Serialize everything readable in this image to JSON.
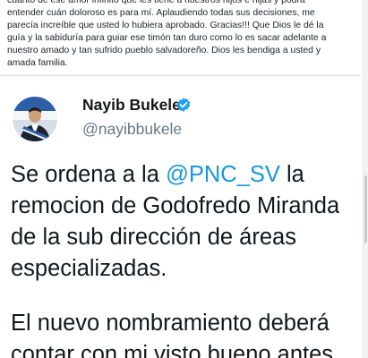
{
  "comment": {
    "lines": [
      "cuanto de ese amor infinito que les tiene a nuestros hijos e hijas y podrá",
      "entender cuán doloroso es para mí. Aplaudiendo todas sus decisiones, me",
      "parecía increíble que usted lo hubiera aprobado. Gracias!!! Que Dios le dé la",
      "guía y la sabiduría para guiar ese timón tan duro como lo es sacar adelante a",
      "nuestro amado y tan sufrido pueblo salvadoreño. Dios les bendiga a usted y",
      "amada familia."
    ]
  },
  "tweet": {
    "display_name": "Nayib Bukele",
    "handle": "@nayibbukele",
    "verified_icon": "verified-badge-icon",
    "avatar_icon": "profile-photo",
    "text": {
      "para1_prefix": "Se ordena a la ",
      "mention": "@PNC_SV",
      "para1_suffix": " la remocion de Godofredo Miranda de la sub dirección de áreas especializadas.",
      "para2": "El nuevo nombramiento deberá contar con mi visto bueno antes"
    }
  },
  "colors": {
    "mention": "#1b95e0",
    "verified": "#1da1f2",
    "handle": "#657786",
    "text": "#14171a"
  }
}
